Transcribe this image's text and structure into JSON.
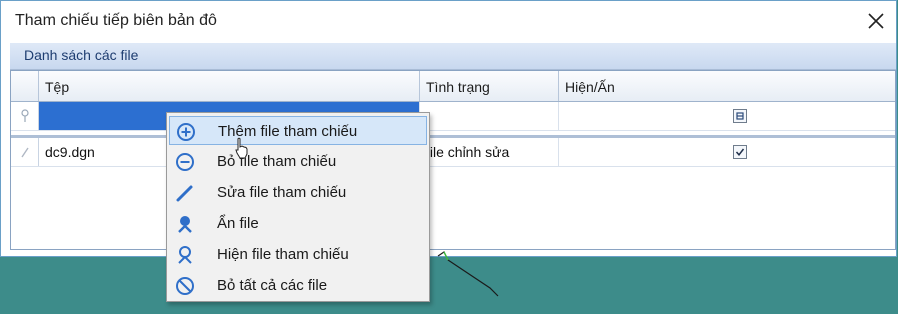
{
  "window": {
    "title": "Tham chiếu tiếp biên bản đô"
  },
  "group": {
    "label": "Danh sách các file"
  },
  "grid": {
    "columns": [
      "Tệp",
      "Tình trạng",
      "Hiện/Ấn"
    ],
    "rows": [
      {
        "file": "",
        "status": "",
        "visible": "partial"
      },
      {
        "file": "dc9.dgn",
        "status": "file chỉnh sửa",
        "visible": "checked"
      }
    ]
  },
  "context_menu": {
    "items": [
      {
        "label": "Thêm file tham chiếu",
        "icon": "plus-circle-icon"
      },
      {
        "label": "Bỏ file tham chiếu",
        "icon": "minus-circle-icon"
      },
      {
        "label": "Sửa file tham chiếu",
        "icon": "pencil-icon"
      },
      {
        "label": "Ẩn file",
        "icon": "pin-hide-icon"
      },
      {
        "label": "Hiện file tham chiếu",
        "icon": "pin-show-icon"
      },
      {
        "label": "Bỏ tất cả các file",
        "icon": "no-entry-icon"
      }
    ],
    "highlighted_index": 0
  },
  "colors": {
    "selection": "#2c6fd1",
    "menu_icon": "#2f6fc9",
    "background": "#3d8c8a"
  }
}
